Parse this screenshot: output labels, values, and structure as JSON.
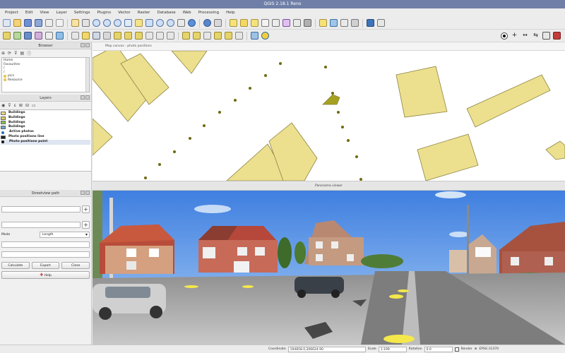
{
  "window": {
    "title": "QGIS 2.18.1 Reno"
  },
  "menu": [
    "Project",
    "Edit",
    "View",
    "Layer",
    "Settings",
    "Plugins",
    "Vector",
    "Raster",
    "Database",
    "Web",
    "Processing",
    "Help"
  ],
  "browser": {
    "title": "Browser",
    "items": [
      "Home",
      "Favourites",
      "/",
      "pics",
      "Resource"
    ]
  },
  "layers": {
    "title": "Layers",
    "items": [
      {
        "label": "Buildings",
        "color": "#e8dc8c"
      },
      {
        "label": "Buildings",
        "color": "#d9cd5a"
      },
      {
        "label": "Buildings",
        "color": "#8fbf4f"
      },
      {
        "label": "Buildings",
        "color": "#6fa2c5"
      },
      {
        "label": "Active photos",
        "color": "#2a6ebb"
      },
      {
        "label": "Photo positions line",
        "color": "#222222"
      },
      {
        "label": "Photo positions point",
        "color": "#111111"
      }
    ]
  },
  "streetview": {
    "title": "Streetview path",
    "mode_label": "Mode",
    "mode_value": "Length",
    "btn_calculate": "Calculate",
    "btn_export": "Export",
    "btn_close": "Close",
    "btn_help": "Help"
  },
  "map": {
    "tab_label": "Map canvas - photo positions",
    "building_color": "#ece08f",
    "building_stroke": "#8c8240",
    "point_color": "#6e6a10"
  },
  "panorama": {
    "title": "Panorama viewer"
  },
  "status": {
    "coordinate_label": "Coordinate",
    "coordinate_value": "194858.0,206624.90",
    "scale_label": "Scale",
    "scale_value": "1:199",
    "rotation_label": "Rotation",
    "rotation_value": "0.0",
    "render_label": "Render",
    "crs_label": "EPSG:31370"
  }
}
